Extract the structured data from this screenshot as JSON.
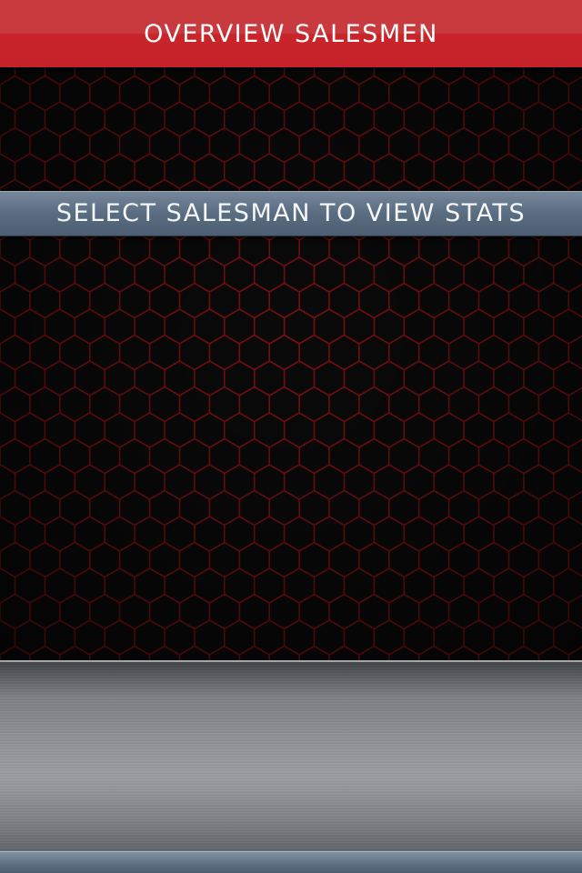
{
  "header": {
    "title": "OVERVIEW SALESMEN"
  },
  "prompt": {
    "text": "SELECT SALESMAN TO VIEW STATS"
  },
  "colors": {
    "header_red": "#c9242a",
    "hex_line": "#7a0f12",
    "prompt_bar": "#5a6c80",
    "metal": "#8d9195"
  }
}
